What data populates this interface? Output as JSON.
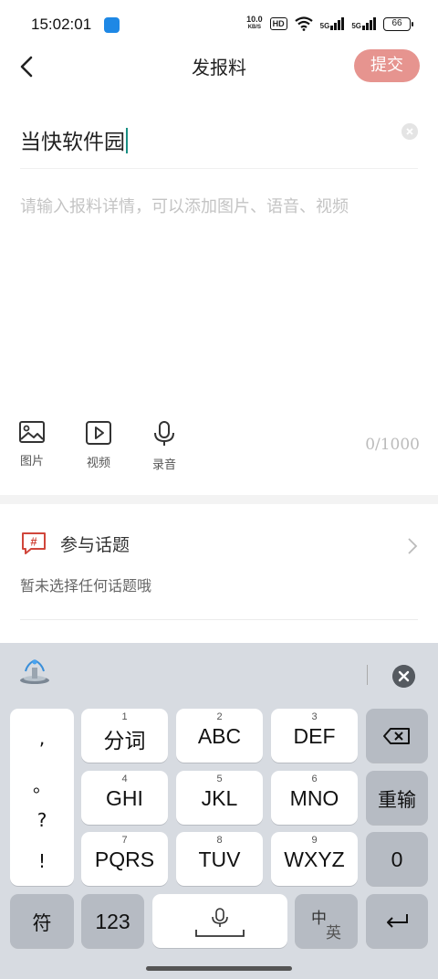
{
  "status_bar": {
    "time": "15:02:01",
    "net_speed_value": "10.0",
    "net_speed_unit": "KB/S",
    "hd_badge": "HD",
    "signal_1": "5G",
    "signal_2": "5G",
    "battery": "66"
  },
  "header": {
    "title": "发报料",
    "submit_label": "提交"
  },
  "editor": {
    "title_value": "当快软件园",
    "detail_placeholder": "请输入报料详情，可以添加图片、语音、视频",
    "media_buttons": [
      {
        "label": "图片",
        "icon": "image-icon"
      },
      {
        "label": "视频",
        "icon": "video-icon"
      },
      {
        "label": "录音",
        "icon": "microphone-icon"
      }
    ],
    "char_counter": "0/1000"
  },
  "topic": {
    "title": "参与话题",
    "icon_glyph": "#",
    "subtitle": "暂未选择任何话题哦"
  },
  "keyboard": {
    "punctuation": [
      ",",
      "。",
      "?",
      "!"
    ],
    "row1": [
      {
        "num": "1",
        "label": "分词"
      },
      {
        "num": "2",
        "label": "ABC"
      },
      {
        "num": "3",
        "label": "DEF"
      }
    ],
    "row2": [
      {
        "num": "4",
        "label": "GHI"
      },
      {
        "num": "5",
        "label": "JKL"
      },
      {
        "num": "6",
        "label": "MNO"
      }
    ],
    "row3": [
      {
        "num": "7",
        "label": "PQRS"
      },
      {
        "num": "8",
        "label": "TUV"
      },
      {
        "num": "9",
        "label": "WXYZ"
      }
    ],
    "reenter_label": "重输",
    "zero_label": "0",
    "symbol_label": "符",
    "numeric_label": "123",
    "lang_cn": "中",
    "lang_en": "英",
    "colors": {
      "background": "#d7dbe1",
      "key": "#ffffff",
      "dark_key": "#b6bbc3"
    }
  },
  "colors": {
    "submit_button": "#e6948f",
    "caret": "#1a8f83",
    "topic_icon": "#d0463b"
  }
}
